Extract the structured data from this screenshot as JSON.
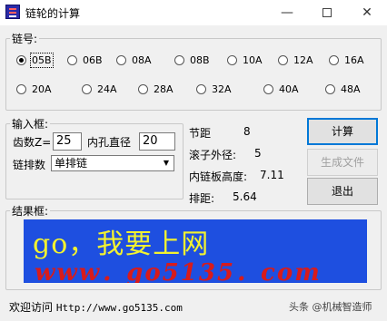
{
  "window": {
    "title": "链轮的计算",
    "minimize_glyph": "—",
    "close_glyph": "✕"
  },
  "chain_group": {
    "legend": "链号:",
    "selected": "05B",
    "options": [
      "05B",
      "06B",
      "08A",
      "08B",
      "10A",
      "12A",
      "16A",
      "20A",
      "24A",
      "28A",
      "32A",
      "40A",
      "48A"
    ]
  },
  "input_group": {
    "legend": "输入框:",
    "teeth_label": "齿数Z=",
    "teeth_value": "25",
    "bore_label": "内孔直径",
    "bore_value": "20",
    "rows_label": "链排数",
    "rows_value": "单排链"
  },
  "results": {
    "pitch_label": "节距",
    "pitch_value": "8",
    "roller_label": "滚子外径:",
    "roller_value": "5",
    "plate_label": "内链板高度:",
    "plate_value": "7.11",
    "row_pitch_label": "排距:",
    "row_pitch_value": "5.64"
  },
  "buttons": {
    "calculate": "计算",
    "generate": "生成文件",
    "exit": "退出"
  },
  "banner_group": {
    "legend": "结果框:",
    "line1": "go，我要上网",
    "line2": "www．go5135．com"
  },
  "footer": {
    "prefix": "欢迎访问",
    "url": "Http://www.go5135.com"
  },
  "watermark": "头条 @机械智造师"
}
